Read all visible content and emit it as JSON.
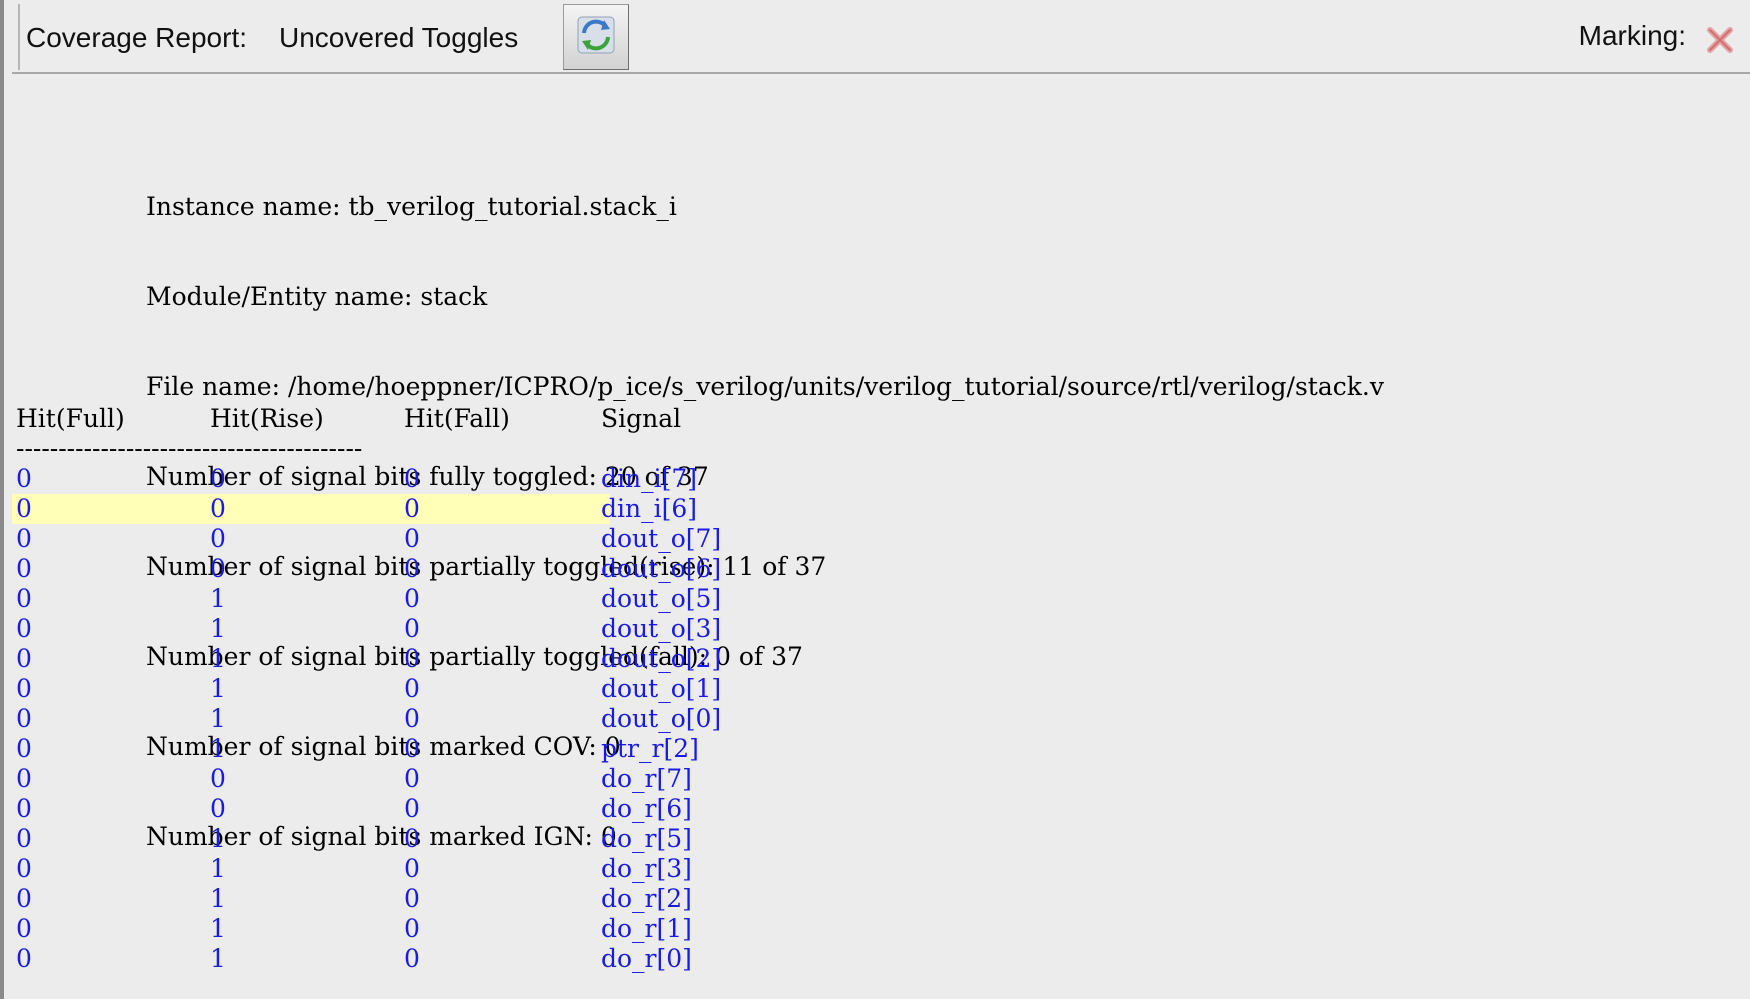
{
  "header": {
    "label": "Coverage Report:",
    "report_type": "Uncovered Toggles",
    "refresh_icon": "refresh-icon",
    "marking_label": "Marking:",
    "marking_icon": "close-icon"
  },
  "info": {
    "instance": "Instance name: tb_verilog_tutorial.stack_i",
    "module": "Module/Entity name: stack",
    "file": "File name: /home/hoeppner/ICPRO/p_ice/s_verilog/units/verilog_tutorial/source/rtl/verilog/stack.v",
    "fully_toggled": "Number of signal bits fully toggled: 20 of 37",
    "partial_rise": "Number of signal bits partially toggled(rise): 11 of 37",
    "partial_fall": "Number of signal bits partially toggled(fall): 0 of 37",
    "marked_cov": "Number of signal bits marked COV: 0",
    "marked_ign": "Number of signal bits marked IGN: 0"
  },
  "table": {
    "headers": [
      "Hit(Full)",
      "Hit(Rise)",
      "Hit(Fall)",
      "Signal"
    ],
    "divider": "-----------------------------------------",
    "rows": [
      {
        "full": "0",
        "rise": "0",
        "fall": "0",
        "signal": "din_i[7]"
      },
      {
        "full": "0",
        "rise": "0",
        "fall": "0",
        "signal": "din_i[6]"
      },
      {
        "full": "0",
        "rise": "0",
        "fall": "0",
        "signal": "dout_o[7]"
      },
      {
        "full": "0",
        "rise": "0",
        "fall": "0",
        "signal": "dout_o[6]"
      },
      {
        "full": "0",
        "rise": "1",
        "fall": "0",
        "signal": "dout_o[5]"
      },
      {
        "full": "0",
        "rise": "1",
        "fall": "0",
        "signal": "dout_o[3]"
      },
      {
        "full": "0",
        "rise": "1",
        "fall": "0",
        "signal": "dout_o[2]"
      },
      {
        "full": "0",
        "rise": "1",
        "fall": "0",
        "signal": "dout_o[1]"
      },
      {
        "full": "0",
        "rise": "1",
        "fall": "0",
        "signal": "dout_o[0]"
      },
      {
        "full": "0",
        "rise": "1",
        "fall": "0",
        "signal": "ptr_r[2]"
      },
      {
        "full": "0",
        "rise": "0",
        "fall": "0",
        "signal": "do_r[7]"
      },
      {
        "full": "0",
        "rise": "0",
        "fall": "0",
        "signal": "do_r[6]"
      },
      {
        "full": "0",
        "rise": "1",
        "fall": "0",
        "signal": "do_r[5]"
      },
      {
        "full": "0",
        "rise": "1",
        "fall": "0",
        "signal": "do_r[3]"
      },
      {
        "full": "0",
        "rise": "1",
        "fall": "0",
        "signal": "do_r[2]"
      },
      {
        "full": "0",
        "rise": "1",
        "fall": "0",
        "signal": "do_r[1]"
      },
      {
        "full": "0",
        "rise": "1",
        "fall": "0",
        "signal": "do_r[0]"
      }
    ]
  },
  "colors": {
    "link": "#1a1ae6",
    "highlight": "#ffffb8",
    "background": "#ececec"
  }
}
